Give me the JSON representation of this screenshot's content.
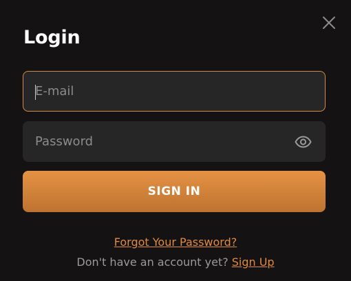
{
  "modal": {
    "title": "Login",
    "close_icon": "close-icon"
  },
  "form": {
    "email": {
      "placeholder": "E-mail",
      "value": ""
    },
    "password": {
      "placeholder": "Password",
      "value": "",
      "toggle_icon": "eye-icon"
    },
    "submit_label": "SIGN IN"
  },
  "links": {
    "forgot_password": "Forgot Your Password?",
    "no_account_text": "Don't have an account yet?",
    "sign_up": "Sign Up"
  },
  "colors": {
    "background": "#141212",
    "field_background": "#262626",
    "accent": "#e08a3f",
    "button_gradient_top": "#e69244",
    "button_gradient_bottom": "#bd7330"
  }
}
